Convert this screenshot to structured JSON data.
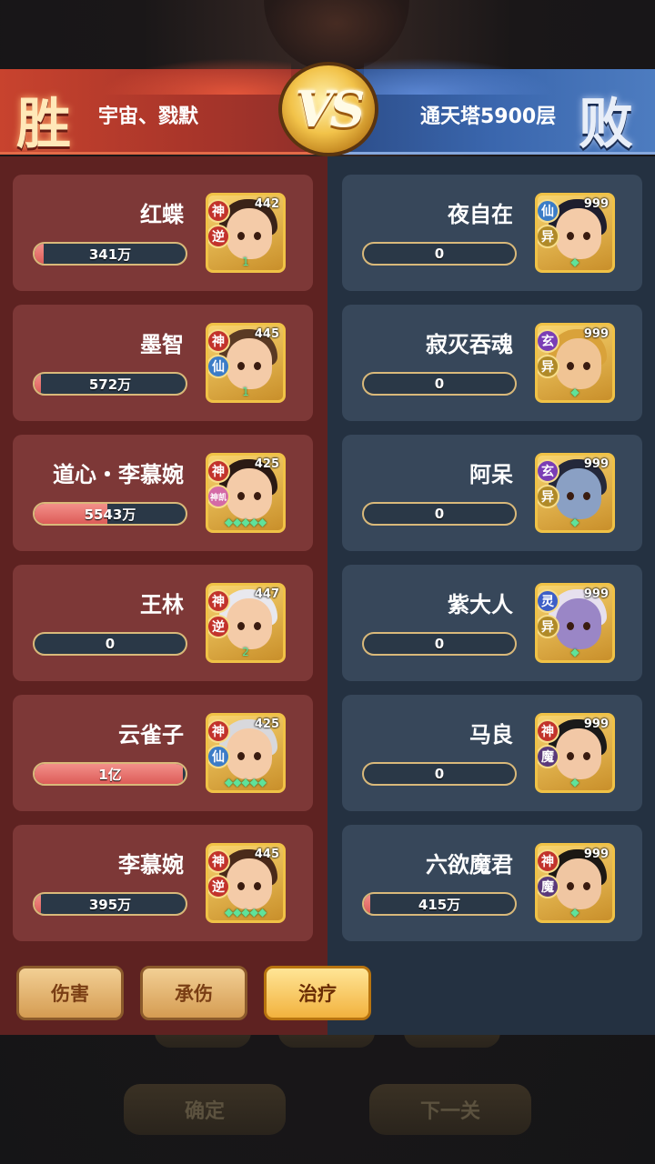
{
  "header": {
    "win_char": "胜",
    "lose_char": "败",
    "vs_text": "VS",
    "left_team": "宇宙、戮默",
    "right_team": "通天塔5900层"
  },
  "colors": {
    "win_red": "#c8432e",
    "lose_blue": "#3a66ad",
    "bar_fill": "#dd5c58",
    "bar_border": "#d9b97a"
  },
  "left_heroes": [
    {
      "name": "红蝶",
      "value": "341万",
      "fill": 0.06,
      "level": "442",
      "tag1": "神",
      "tag2": "逆",
      "stars": "1"
    },
    {
      "name": "墨智",
      "value": "572万",
      "fill": 0.04,
      "level": "445",
      "tag1": "神",
      "tag2": "仙",
      "stars": "1"
    },
    {
      "name": "道心・李慕婉",
      "value": "5543万",
      "fill": 0.48,
      "level": "425",
      "tag1": "神",
      "tag2": "神凯",
      "stars": "◆◆◆◆◆"
    },
    {
      "name": "王林",
      "value": "0",
      "fill": 0,
      "level": "447",
      "tag1": "神",
      "tag2": "逆",
      "stars": "2"
    },
    {
      "name": "云雀子",
      "value": "1亿",
      "fill": 0.98,
      "level": "425",
      "tag1": "神",
      "tag2": "仙",
      "stars": "◆◆◆◆◆"
    },
    {
      "name": "李慕婉",
      "value": "395万",
      "fill": 0.04,
      "level": "445",
      "tag1": "神",
      "tag2": "逆",
      "stars": "◆◆◆◆◆"
    }
  ],
  "right_heroes": [
    {
      "name": "夜自在",
      "value": "0",
      "fill": 0,
      "level": "999",
      "tag1": "仙",
      "tag2": "异"
    },
    {
      "name": "寂灭吞魂",
      "value": "0",
      "fill": 0,
      "level": "999",
      "tag1": "玄",
      "tag2": "异"
    },
    {
      "name": "阿呆",
      "value": "0",
      "fill": 0,
      "level": "999",
      "tag1": "玄",
      "tag2": "异"
    },
    {
      "name": "紫大人",
      "value": "0",
      "fill": 0,
      "level": "999",
      "tag1": "灵",
      "tag2": "异"
    },
    {
      "name": "马良",
      "value": "0",
      "fill": 0,
      "level": "999",
      "tag1": "神",
      "tag2": "魔"
    },
    {
      "name": "六欲魔君",
      "value": "415万",
      "fill": 0.04,
      "level": "999",
      "tag1": "神",
      "tag2": "魔"
    }
  ],
  "tabs": [
    {
      "label": "伤害",
      "active": false
    },
    {
      "label": "承伤",
      "active": false
    },
    {
      "label": "治疗",
      "active": true
    }
  ],
  "background_buttons": {
    "confirm": "确定",
    "next_level": "下一关"
  }
}
